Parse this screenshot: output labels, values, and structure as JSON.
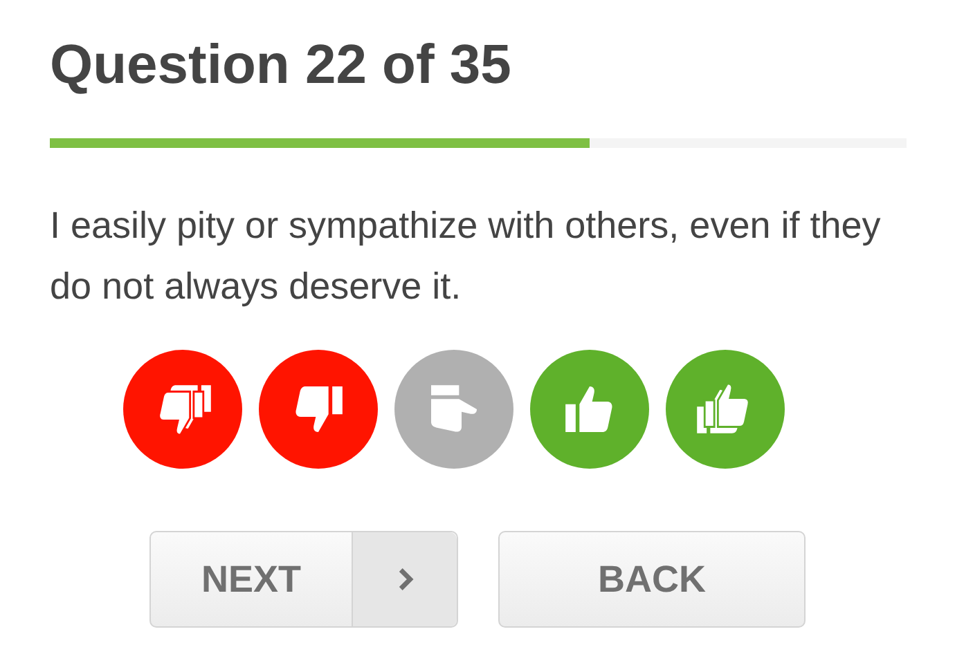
{
  "title": "Question 22 of 35",
  "progress": {
    "level": 0.63
  },
  "question": "I easily pity or sympathize with others, even if they do not always deserve it.",
  "answers": [
    {
      "kind": "double_down",
      "color": "#ff1400"
    },
    {
      "kind": "down",
      "color": "#ff1400"
    },
    {
      "kind": "sideways",
      "color": "#b0b0b0"
    },
    {
      "kind": "up",
      "color": "#5fb12b"
    },
    {
      "kind": "double_up",
      "color": "#5fb12b"
    }
  ],
  "buttons": {
    "next": "NEXT",
    "back": "BACK"
  }
}
